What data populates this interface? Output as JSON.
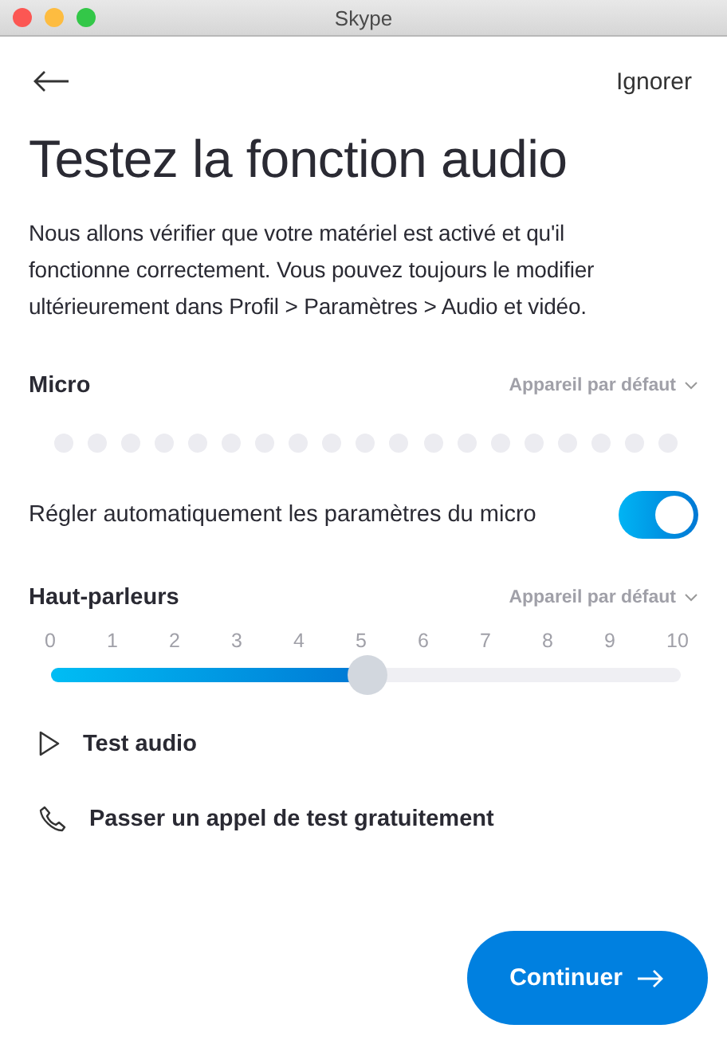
{
  "window": {
    "title": "Skype"
  },
  "header": {
    "skip": "Ignorer"
  },
  "title": "Testez la fonction audio",
  "description": "Nous allons vérifier que votre matériel est activé et qu'il fonctionne correctement. Vous pouvez toujours le modifier ultérieurement dans Profil > Paramètres > Audio et vidéo.",
  "microphone": {
    "label": "Micro",
    "device": "Appareil par défaut"
  },
  "auto_adjust": {
    "label": "Régler automatiquement les paramètres du micro",
    "on": true
  },
  "speakers": {
    "label": "Haut-parleurs",
    "device": "Appareil par défaut",
    "ticks": [
      "0",
      "1",
      "2",
      "3",
      "4",
      "5",
      "6",
      "7",
      "8",
      "9",
      "10"
    ],
    "level": 0.5
  },
  "actions": [
    {
      "kind": "play",
      "label": "Test audio"
    },
    {
      "kind": "call",
      "label": "Passer un appel de test gratuitement"
    }
  ],
  "continue_button": "Continuer"
}
